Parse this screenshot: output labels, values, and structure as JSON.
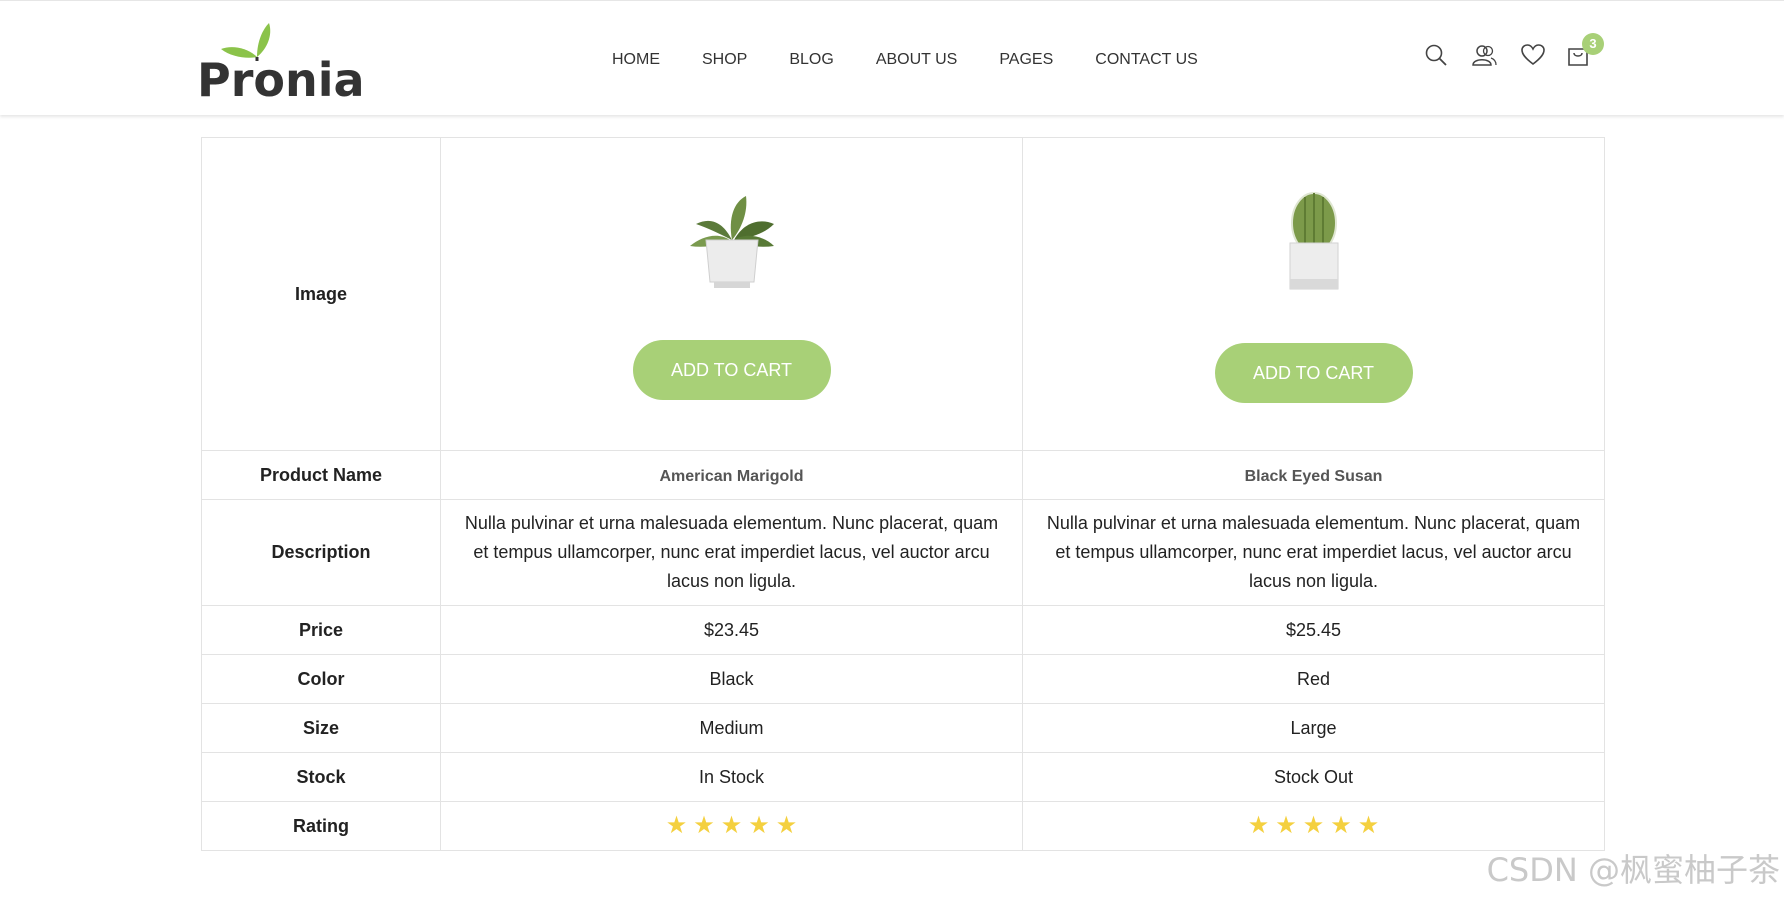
{
  "brand": {
    "name": "Pronia"
  },
  "nav": {
    "items": [
      {
        "label": "HOME"
      },
      {
        "label": "SHOP"
      },
      {
        "label": "BLOG"
      },
      {
        "label": "ABOUT US"
      },
      {
        "label": "PAGES"
      },
      {
        "label": "CONTACT US"
      }
    ]
  },
  "header_icons": {
    "search": "search-icon",
    "account": "user-icon",
    "wishlist": "heart-icon",
    "cart": "shopping-bag-icon",
    "cart_count": "3"
  },
  "colors": {
    "accent": "#a8d077",
    "star": "#f4d03f"
  },
  "compare": {
    "row_labels": {
      "image": "Image",
      "name": "Product Name",
      "description": "Description",
      "price": "Price",
      "color": "Color",
      "size": "Size",
      "stock": "Stock",
      "rating": "Rating"
    },
    "products": [
      {
        "image": "plant-in-white-pot",
        "button": "ADD TO CART",
        "name": "American Marigold",
        "description": "Nulla pulvinar et urna malesuada elementum. Nunc placerat, quam et tempus ullamcorper, nunc erat imperdiet lacus, vel auctor arcu lacus non ligula.",
        "price": "$23.45",
        "color": "Black",
        "size": "Medium",
        "stock": "In Stock",
        "rating": 5
      },
      {
        "image": "cactus-in-white-pot",
        "button": "ADD TO CART",
        "name": "Black Eyed Susan",
        "description": "Nulla pulvinar et urna malesuada elementum. Nunc placerat, quam et tempus ullamcorper, nunc erat imperdiet lacus, vel auctor arcu lacus non ligula.",
        "price": "$25.45",
        "color": "Red",
        "size": "Large",
        "stock": "Stock Out",
        "rating": 5
      }
    ]
  },
  "watermark": "CSDN @枫蜜柚子茶"
}
